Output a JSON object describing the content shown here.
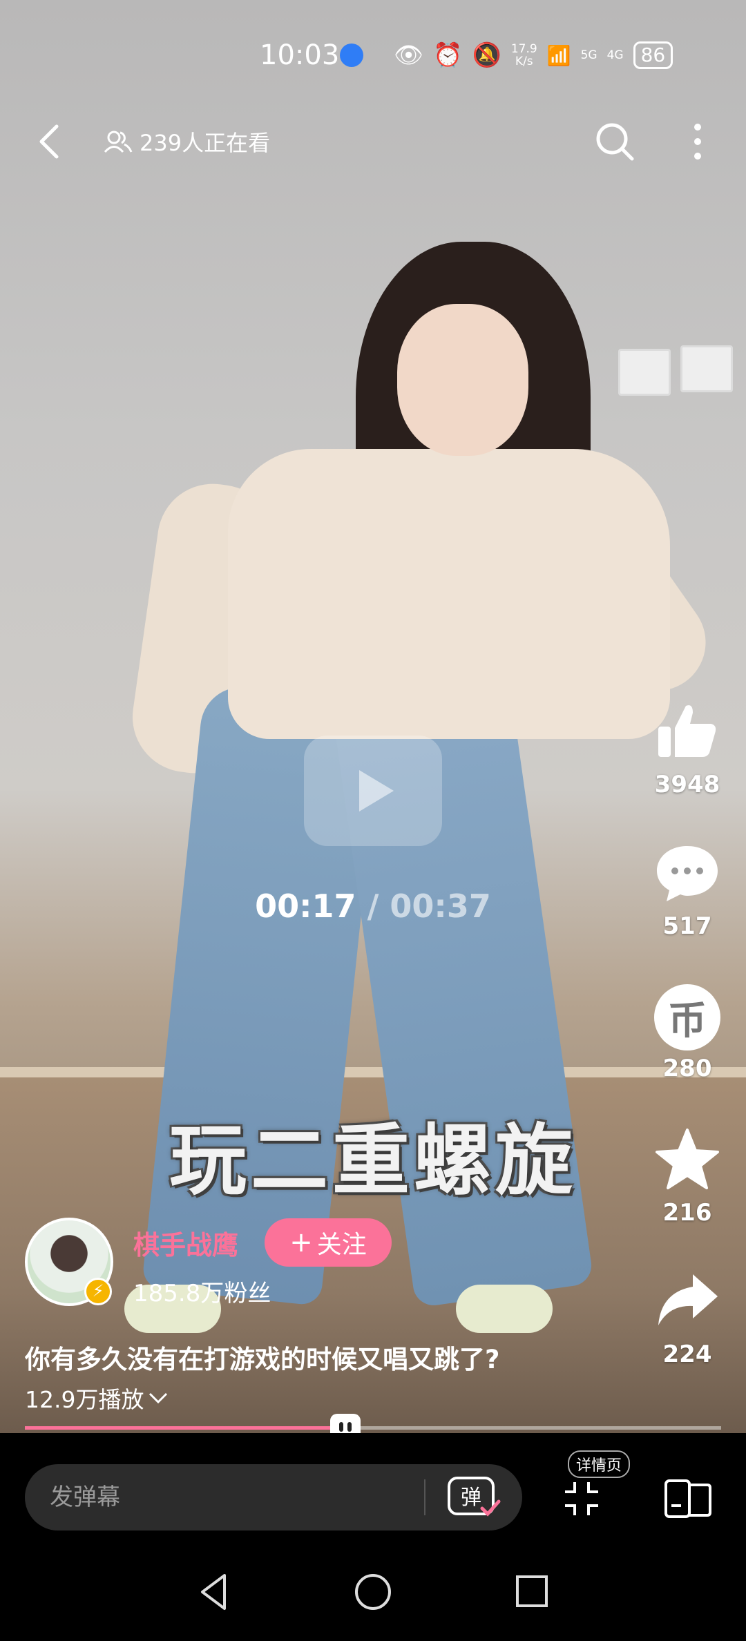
{
  "status_bar": {
    "time": "10:03",
    "net_speed_top": "17.9",
    "net_speed_bottom": "K/s",
    "signal_5g": "5G",
    "signal_4g": "4G",
    "battery": "86"
  },
  "top_nav": {
    "watching_text": "239人正在看"
  },
  "video": {
    "current_time": "00:17",
    "separator": " / ",
    "duration": "00:37",
    "subtitle": "玩二重螺旋",
    "progress_fraction": 0.46
  },
  "actions": {
    "likes": "3948",
    "comments": "517",
    "coins": "280",
    "coin_glyph": "币",
    "favorites": "216",
    "shares": "224"
  },
  "author": {
    "name": "棋手战鹰",
    "follow_label": "关注",
    "fans": "185.8万粉丝"
  },
  "post": {
    "title": "你有多久没有在打游戏的时候又唱又跳了?",
    "plays": "12.9万播放"
  },
  "bottom_bar": {
    "danmaku_placeholder": "发弹幕",
    "danmaku_toggle": "弹",
    "detail_label": "详情页"
  },
  "colors": {
    "accent": "#fb7299"
  },
  "icons": [
    "back-icon",
    "viewers-icon",
    "search-icon",
    "more-icon",
    "play-icon",
    "like-icon",
    "comment-icon",
    "coin-icon",
    "favorite-icon",
    "share-icon",
    "collapse-icon",
    "rotate-icon"
  ]
}
